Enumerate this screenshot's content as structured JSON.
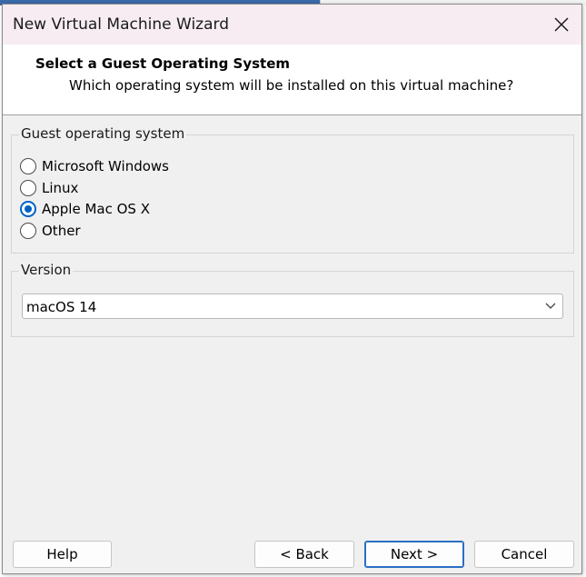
{
  "dialog": {
    "title": "New Virtual Machine Wizard"
  },
  "header": {
    "title": "Select a Guest Operating System",
    "subtitle": "Which operating system will be installed on this virtual machine?"
  },
  "guest_os": {
    "legend": "Guest operating system",
    "options": [
      {
        "label": "Microsoft Windows",
        "selected": false
      },
      {
        "label": "Linux",
        "selected": false
      },
      {
        "label": "Apple Mac OS X",
        "selected": true
      },
      {
        "label": "Other",
        "selected": false
      }
    ]
  },
  "version": {
    "legend": "Version",
    "selected": "macOS 14"
  },
  "buttons": {
    "help": "Help",
    "back": "< Back",
    "next": "Next >",
    "cancel": "Cancel"
  },
  "icons": {
    "close": "close-icon",
    "dropdown": "chevron-down-icon"
  },
  "colors": {
    "accent": "#0062c4",
    "title_bar": "#f6ecf1",
    "dialog_bg": "#f0f0f0"
  }
}
